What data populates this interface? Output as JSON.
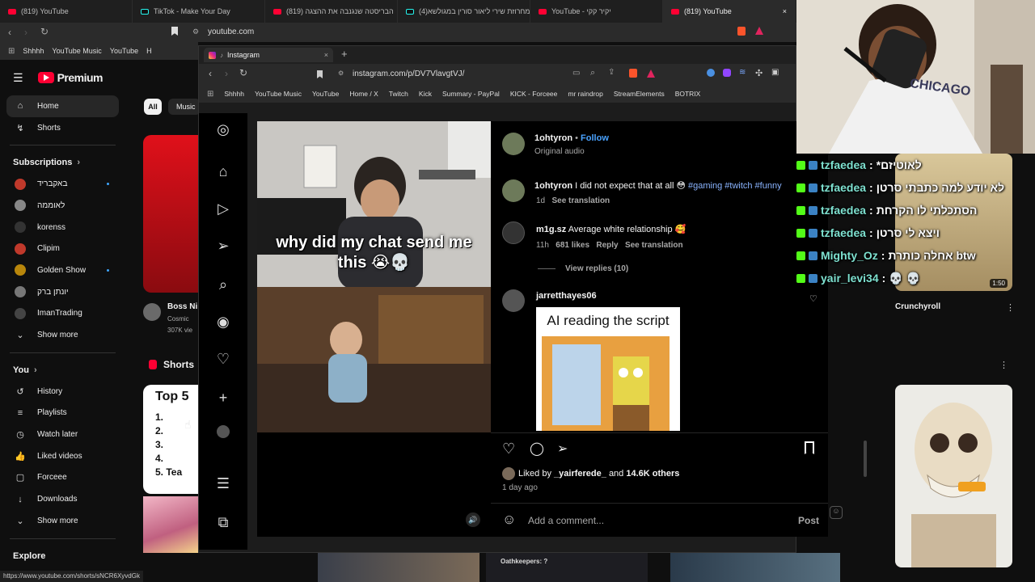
{
  "tabs": [
    {
      "label": "(819) YouTube",
      "type": "yt"
    },
    {
      "label": "TikTok - Make Your Day",
      "type": "tt"
    },
    {
      "label": "(819) הבריסטה שנגנבה את ההצגה",
      "type": "yt"
    },
    {
      "label": "(4)מחרוזת שירי ליאור סורין במגולשא",
      "type": "tt"
    },
    {
      "label": "YouTube - יקיר קקי",
      "type": "yt"
    },
    {
      "label": "(819) YouTube",
      "type": "yt",
      "active": true
    }
  ],
  "outer_url": "youtube.com",
  "outer_bookmarks": [
    "Shhhh",
    "YouTube Music",
    "YouTube",
    "H"
  ],
  "yt": {
    "logo": "Premium",
    "sidebar": {
      "main": [
        {
          "label": "Home",
          "icon": "home-icon",
          "glyph": "⌂",
          "active": true
        },
        {
          "label": "Shorts",
          "icon": "shorts-icon",
          "glyph": "↯"
        }
      ],
      "subs_title": "Subscriptions",
      "subs": [
        {
          "label": "באקבריד",
          "dot": true
        },
        {
          "label": "לאוממה"
        },
        {
          "label": "korenss"
        },
        {
          "label": "Clipim"
        },
        {
          "label": "Golden Show",
          "dot": true
        },
        {
          "label": "יונתן ברק"
        },
        {
          "label": "ImanTrading"
        }
      ],
      "show_more": "Show more",
      "you_title": "You",
      "you": [
        {
          "label": "History",
          "glyph": "↺"
        },
        {
          "label": "Playlists",
          "glyph": "≡"
        },
        {
          "label": "Watch later",
          "glyph": "◷"
        },
        {
          "label": "Liked videos",
          "glyph": "👍"
        },
        {
          "label": "Forceee",
          "glyph": "▢"
        },
        {
          "label": "Downloads",
          "glyph": "↓"
        }
      ],
      "show_more2": "Show more",
      "explore": "Explore"
    },
    "chips": [
      "All",
      "Music"
    ],
    "boss_title": "Boss Ni",
    "boss_sub": "Cosmic",
    "boss_views": "307K vie",
    "shorts_label": "Shorts",
    "short_card_title": "Top 5",
    "short_card_lines": [
      "1.",
      "2.",
      "3.",
      "4.",
      "5. Tea"
    ],
    "crunchy": "Crunchyroll",
    "duration": "1:50",
    "oath": "Oathkeepers: ?",
    "status_url": "https://www.youtube.com/shorts/sNCR6XyvdGk"
  },
  "ig": {
    "tab_label": "Instagram",
    "url": "instagram.com/p/DV7VlavgtVJ/",
    "bookmarks": [
      "Shhhh",
      "YouTube Music",
      "YouTube",
      "Home / X",
      "Twitch",
      "Kick",
      "Summary - PayPal",
      "KICK - Forceee",
      "mr raindrop",
      "StreamElements",
      "BOTRIX"
    ],
    "video_caption": "why did my chat send me this 😭💀",
    "author": "1ohtyron",
    "follow": "Follow",
    "audio": "Original audio",
    "caption_user": "1ohtyron",
    "caption_text": "I did not expect that at all 😳",
    "caption_tags": "#gaming #twitch #funny",
    "caption_age": "1d",
    "see_translation": "See translation",
    "comment1_user": "m1g.sz",
    "comment1_text": "Average white relationship 🥰",
    "comment1_age": "11h",
    "comment1_likes": "681 likes",
    "reply": "Reply",
    "view_replies": "View replies (10)",
    "comment2_user": "jarretthayes06",
    "gif_caption": "AI reading the script",
    "liked_by_prefix": "Liked by",
    "liked_by_user": "_yairferede_",
    "liked_by_and": "and",
    "liked_by_count": "14.6K others",
    "post_age": "1 day ago",
    "comment_placeholder": "Add a comment...",
    "post_button": "Post"
  },
  "chat": [
    {
      "name": "tzfaedea",
      "msg": "*לאוטיזם"
    },
    {
      "name": "tzfaedea",
      "msg": "לא יודע למה כתבתי סרטן"
    },
    {
      "name": "tzfaedea",
      "msg": "הסתכלתי לו הקרחת"
    },
    {
      "name": "tzfaedea",
      "msg": "ויצא לי סרטן"
    },
    {
      "name": "Mighty_Oz",
      "msg": "אחלה כותרת btw"
    },
    {
      "name": "yair_levi34",
      "msg": "💀 💀"
    }
  ],
  "cam_text": "CHICAGO"
}
